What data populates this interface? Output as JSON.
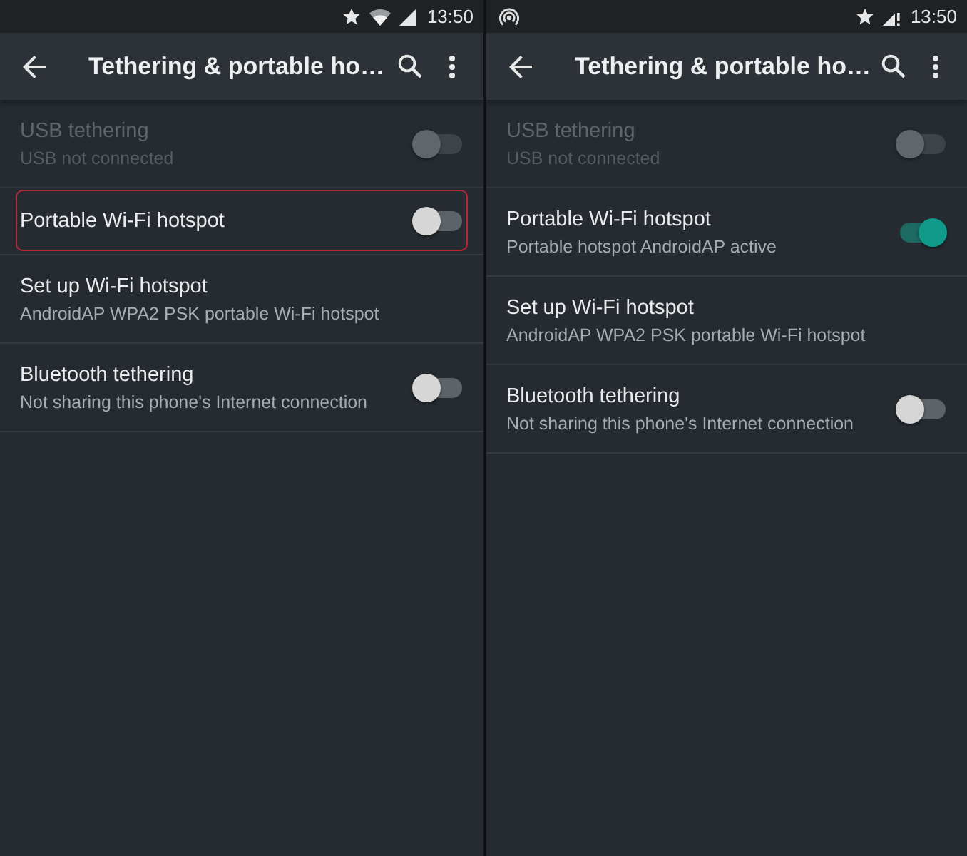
{
  "screens": [
    {
      "status_bar": {
        "hotspot": false,
        "wifi": true,
        "signal_warning": false,
        "time": "13:50"
      },
      "toolbar": {
        "title": "Tethering & portable ho…"
      },
      "items": [
        {
          "kind": "switch",
          "title": "USB tethering",
          "summary": "USB not connected",
          "disabled": true,
          "on": false,
          "highlighted": false
        },
        {
          "kind": "switch",
          "title": "Portable Wi-Fi hotspot",
          "disabled": false,
          "on": false,
          "highlighted": true
        },
        {
          "kind": "link",
          "title": "Set up Wi-Fi hotspot",
          "summary": "AndroidAP WPA2 PSK portable Wi-Fi hotspot",
          "disabled": false,
          "highlighted": false
        },
        {
          "kind": "switch",
          "title": "Bluetooth tethering",
          "summary": "Not sharing this phone's Internet connection",
          "disabled": false,
          "on": false,
          "highlighted": false
        }
      ]
    },
    {
      "status_bar": {
        "hotspot": true,
        "wifi": false,
        "signal_warning": true,
        "time": "13:50"
      },
      "toolbar": {
        "title": "Tethering & portable ho…"
      },
      "items": [
        {
          "kind": "switch",
          "title": "USB tethering",
          "summary": "USB not connected",
          "disabled": true,
          "on": false,
          "highlighted": false
        },
        {
          "kind": "switch",
          "title": "Portable Wi-Fi hotspot",
          "summary": "Portable hotspot AndroidAP active",
          "disabled": false,
          "on": true,
          "highlighted": false
        },
        {
          "kind": "link",
          "title": "Set up Wi-Fi hotspot",
          "summary": "AndroidAP WPA2 PSK portable Wi-Fi hotspot",
          "disabled": false,
          "highlighted": false
        },
        {
          "kind": "switch",
          "title": "Bluetooth tethering",
          "summary": "Not sharing this phone's Internet connection",
          "disabled": false,
          "on": false,
          "highlighted": false
        }
      ]
    }
  ]
}
